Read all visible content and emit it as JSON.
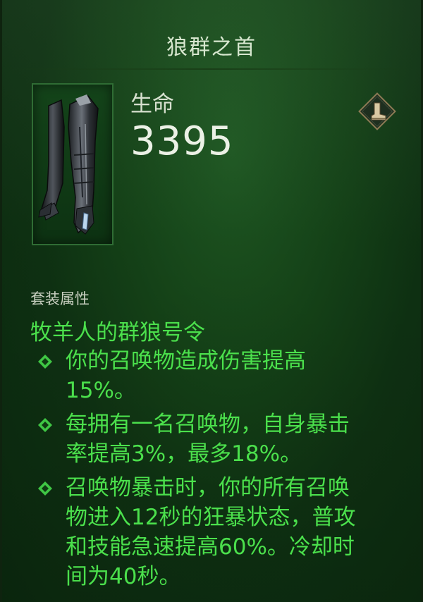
{
  "item": {
    "name": "狼群之首",
    "stat_label": "生命",
    "stat_value": "3395",
    "slot_icon": "boot-slot-icon"
  },
  "set": {
    "section_label": "套装属性",
    "name": "牧羊人的群狼号令",
    "bonuses": [
      {
        "lines": [
          "你的召唤物造成伤害提高",
          "15%。"
        ]
      },
      {
        "lines": [
          "每拥有一名召唤物，自身暴击",
          "率提高3%，最多18%。"
        ]
      },
      {
        "lines": [
          "召唤物暴击时，你的所有召唤",
          "物进入12秒的狂暴状态，普攻",
          "和技能急速提高60%。冷却时",
          "间为40秒。"
        ]
      }
    ]
  },
  "colors": {
    "set_text": "#4be04c",
    "bullet": "#3fc644",
    "background": "#154418"
  }
}
